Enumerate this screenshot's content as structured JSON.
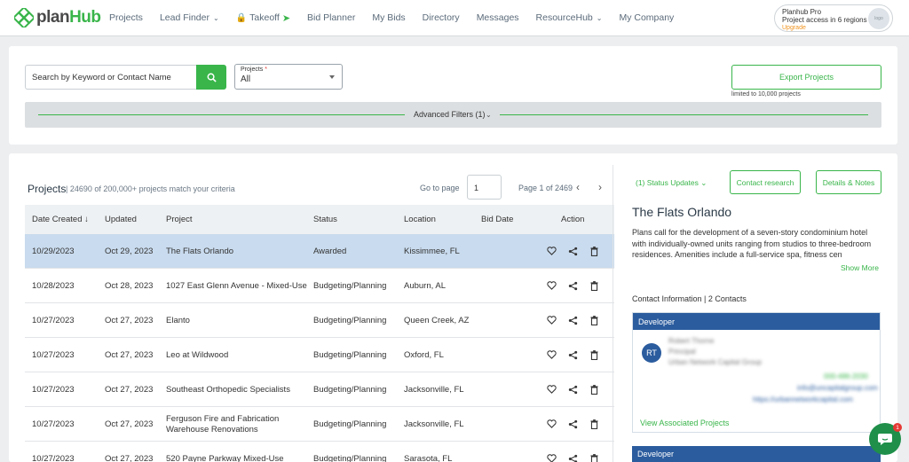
{
  "brand": {
    "name_a": "plan",
    "name_b": "Hub",
    "accent": "#39b54a",
    "primary_blue": "#2b5c9e"
  },
  "nav": {
    "items": [
      {
        "label": "Projects"
      },
      {
        "label": "Lead Finder"
      },
      {
        "label": "Takeoff"
      },
      {
        "label": "Bid Planner"
      },
      {
        "label": "My Bids"
      },
      {
        "label": "Directory"
      },
      {
        "label": "Messages"
      },
      {
        "label": "ResourceHub"
      },
      {
        "label": "My Company"
      }
    ],
    "pro": {
      "title": "Planhub Pro",
      "subtitle": "Project access in 6 regions",
      "upgrade": "Upgrade",
      "avatar": "logo"
    }
  },
  "search": {
    "placeholder": "Search by Keyword or Contact Name",
    "projects_label": "Projects",
    "required_mark": "*",
    "projects_value": "All",
    "export_label": "Export Projects",
    "limit_note": "limited to 10,000 projects",
    "advanced_label": "Advanced Filters (1)"
  },
  "list": {
    "title": "Projects",
    "count_text": "| 24690 of 200,000+ projects match your criteria",
    "goto_label": "Go to page",
    "goto_value": "1",
    "page_of": "Page 1 of 2469",
    "columns": {
      "date_created": "Date Created",
      "updated": "Updated",
      "project": "Project",
      "status": "Status",
      "location": "Location",
      "bid_date": "Bid Date",
      "action": "Action"
    },
    "rows": [
      {
        "created": "10/29/2023",
        "updated": "Oct 29, 2023",
        "project": "The Flats Orlando",
        "project_line2": "",
        "status": "Awarded",
        "location": "Kissimmee, FL",
        "bid_date": ""
      },
      {
        "created": "10/28/2023",
        "updated": "Oct 28, 2023",
        "project": "1027 East Glenn Avenue - Mixed-Use",
        "project_line2": "",
        "status": "Budgeting/Planning",
        "location": "Auburn, AL",
        "bid_date": ""
      },
      {
        "created": "10/27/2023",
        "updated": "Oct 27, 2023",
        "project": "Elanto",
        "project_line2": "",
        "status": "Budgeting/Planning",
        "location": "Queen Creek, AZ",
        "bid_date": ""
      },
      {
        "created": "10/27/2023",
        "updated": "Oct 27, 2023",
        "project": "Leo at Wildwood",
        "project_line2": "",
        "status": "Budgeting/Planning",
        "location": "Oxford, FL",
        "bid_date": ""
      },
      {
        "created": "10/27/2023",
        "updated": "Oct 27, 2023",
        "project": "Southeast Orthopedic Specialists",
        "project_line2": "",
        "status": "Budgeting/Planning",
        "location": "Jacksonville, FL",
        "bid_date": ""
      },
      {
        "created": "10/27/2023",
        "updated": "Oct 27, 2023",
        "project": "Ferguson Fire and Fabrication",
        "project_line2": "Warehouse Renovations",
        "status": "Budgeting/Planning",
        "location": "Jacksonville, FL",
        "bid_date": ""
      },
      {
        "created": "10/27/2023",
        "updated": "Oct 27, 2023",
        "project": "520 Payne Parkway Mixed-Use",
        "project_line2": "",
        "status": "Budgeting/Planning",
        "location": "Sarasota, FL",
        "bid_date": ""
      }
    ]
  },
  "detail": {
    "status_updates": "(1) Status Updates",
    "contact_research": "Contact research",
    "details_notes": "Details & Notes",
    "title": "The Flats Orlando",
    "description": "Plans call for the development of a seven-story condominium hotel with individually-owned units ranging from studios to three-bedroom residences. Amenities include a full-service spa, fitness cen",
    "show_more": "Show More",
    "contact_info": "Contact Information | 2 Contacts",
    "contacts": [
      {
        "role": "Developer",
        "initials": "RT",
        "name": "Robert Thorne",
        "title": "Principal",
        "company": "Urban Network Capital Group",
        "phone": "000-486-2030",
        "email": "info@uncapitalgroup.com",
        "website": "https://urbannetworkcapital.com",
        "view_projects": "View Associated Projects"
      },
      {
        "role": "Developer"
      }
    ]
  },
  "chat": {
    "badge": "1"
  }
}
